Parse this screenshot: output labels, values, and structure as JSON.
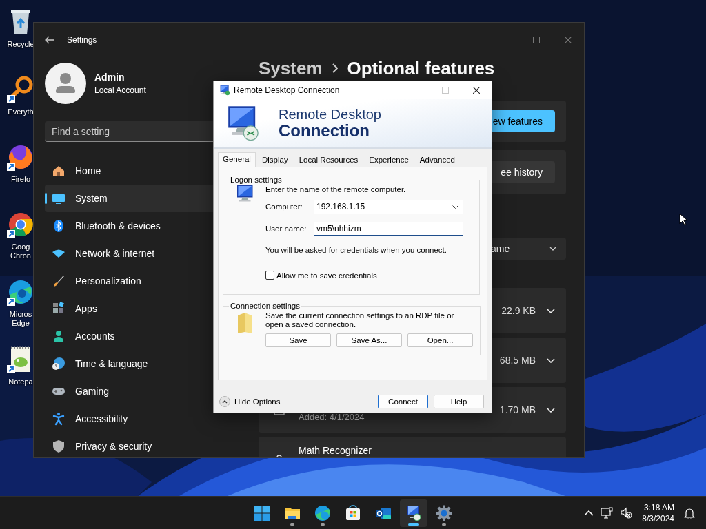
{
  "desktop": {
    "icons": [
      {
        "kind": "recycle-bin",
        "label_lines": [
          "Recycle"
        ],
        "shortcut": false
      },
      {
        "kind": "search-app",
        "label_lines": [
          "Everyth"
        ],
        "shortcut": true
      },
      {
        "kind": "firefox",
        "label_lines": [
          "Firefo"
        ],
        "shortcut": true
      },
      {
        "kind": "chrome",
        "label_lines": [
          "Goog",
          "Chron"
        ],
        "shortcut": true
      },
      {
        "kind": "edge",
        "label_lines": [
          "Micros",
          "Edge"
        ],
        "shortcut": true
      },
      {
        "kind": "notepad",
        "label_lines": [
          "Notepa"
        ],
        "shortcut": true
      }
    ]
  },
  "settings_window": {
    "title": "Settings",
    "user": {
      "name": "Admin",
      "account_type": "Local Account"
    },
    "search": {
      "placeholder": "Find a setting"
    },
    "nav": [
      {
        "kind": "home",
        "label": "Home",
        "selected": false
      },
      {
        "kind": "system",
        "label": "System",
        "selected": true
      },
      {
        "kind": "bluetooth",
        "label": "Bluetooth & devices",
        "selected": false
      },
      {
        "kind": "network",
        "label": "Network & internet",
        "selected": false
      },
      {
        "kind": "personalization",
        "label": "Personalization",
        "selected": false
      },
      {
        "kind": "apps",
        "label": "Apps",
        "selected": false
      },
      {
        "kind": "accounts",
        "label": "Accounts",
        "selected": false
      },
      {
        "kind": "time",
        "label": "Time & language",
        "selected": false
      },
      {
        "kind": "gaming",
        "label": "Gaming",
        "selected": false
      },
      {
        "kind": "accessibility",
        "label": "Accessibility",
        "selected": false
      },
      {
        "kind": "privacy",
        "label": "Privacy & security",
        "selected": false
      }
    ],
    "breadcrumb": {
      "parent": "System",
      "current": "Optional features"
    },
    "cards": [
      {
        "kind": "primary",
        "button": "ew features"
      },
      {
        "kind": "secondary",
        "button": "ee history"
      }
    ],
    "sort": {
      "value": "ame"
    },
    "features": [
      {
        "size": "22.9 KB"
      },
      {
        "size": "68.5 MB"
      },
      {
        "size": "1.70 MB",
        "added": "Added: 4/1/2024"
      },
      {
        "name": "Math Recognizer"
      }
    ]
  },
  "rdc_dialog": {
    "title": "Remote Desktop Connection",
    "banner": {
      "line1": "Remote Desktop",
      "line2": "Connection"
    },
    "tabs": [
      {
        "label": "General",
        "selected": true
      },
      {
        "label": "Display",
        "selected": false
      },
      {
        "label": "Local Resources",
        "selected": false
      },
      {
        "label": "Experience",
        "selected": false
      },
      {
        "label": "Advanced",
        "selected": false
      }
    ],
    "logon": {
      "legend": "Logon settings",
      "prompt": "Enter the name of the remote computer.",
      "computer": {
        "label": "Computer:",
        "value": "192.168.1.15"
      },
      "username": {
        "label": "User name:",
        "value": "vm5\\nhhizm",
        "focused": true
      },
      "note": "You will be asked for credentials when you connect.",
      "save_credentials": {
        "label": "Allow me to save credentials",
        "checked": false
      }
    },
    "connection": {
      "legend": "Connection settings",
      "description": "Save the current connection settings to an RDP file or open a saved connection.",
      "buttons": [
        "Save",
        "Save As...",
        "Open..."
      ]
    },
    "options_toggle": "Hide Options",
    "buttons": [
      {
        "label": "Connect",
        "default": true
      },
      {
        "label": "Help",
        "default": false
      }
    ]
  },
  "taskbar": {
    "apps": [
      {
        "kind": "start",
        "running": false,
        "selected": false
      },
      {
        "kind": "explorer",
        "running": true,
        "selected": false
      },
      {
        "kind": "edge",
        "running": true,
        "selected": false
      },
      {
        "kind": "store",
        "running": false,
        "selected": false
      },
      {
        "kind": "outlook",
        "running": false,
        "selected": false
      },
      {
        "kind": "rdc",
        "running": true,
        "selected": true
      },
      {
        "kind": "settings",
        "running": true,
        "selected": false
      }
    ],
    "clock": {
      "time": "3:18 AM",
      "date": "8/3/2024"
    }
  }
}
